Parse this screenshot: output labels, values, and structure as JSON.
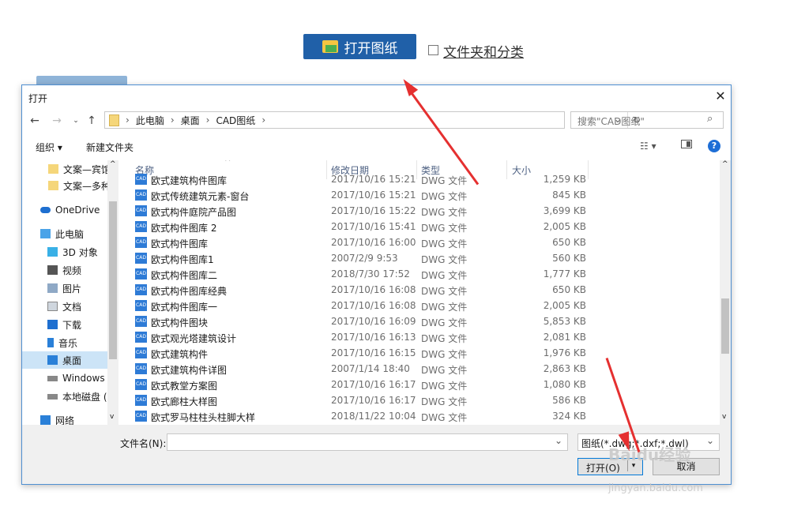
{
  "page": {
    "open_button": "打开图纸",
    "folder_checkbox_label": "文件夹和分类"
  },
  "dialog": {
    "title": "打开",
    "close": "✕",
    "breadcrumb": [
      "此电脑",
      "桌面",
      "CAD图纸"
    ],
    "search_placeholder": "搜索\"CAD图纸\"",
    "toolbar": {
      "organize": "组织 ▾",
      "new_folder": "新建文件夹",
      "help": "?"
    },
    "nav_items": [
      {
        "label": "文案—宾馆",
        "icon": "folder-icon"
      },
      {
        "label": "文案—多种",
        "icon": "folder-icon"
      },
      {
        "label": "OneDrive",
        "icon": "onedrive-icon"
      },
      {
        "label": "此电脑",
        "icon": "computer-icon"
      },
      {
        "label": "3D 对象",
        "icon": "3d-objects-icon"
      },
      {
        "label": "视频",
        "icon": "video-icon"
      },
      {
        "label": "图片",
        "icon": "pictures-icon"
      },
      {
        "label": "文档",
        "icon": "documents-icon"
      },
      {
        "label": "下载",
        "icon": "download-icon"
      },
      {
        "label": "音乐",
        "icon": "music-icon"
      },
      {
        "label": "桌面",
        "icon": "desktop-icon"
      },
      {
        "label": "Windows (",
        "icon": "drive-icon"
      },
      {
        "label": "本地磁盘 (I",
        "icon": "drive-icon"
      },
      {
        "label": "网络",
        "icon": "network-icon"
      }
    ],
    "columns": {
      "name": "名称",
      "date": "修改日期",
      "type": "类型",
      "size": "大小"
    },
    "files": [
      {
        "name": "欧式建筑构件图库",
        "date": "2017/10/16 15:21",
        "type": "DWG 文件",
        "size": "1,259 KB"
      },
      {
        "name": "欧式传统建筑元素-窗台",
        "date": "2017/10/16 15:21",
        "type": "DWG 文件",
        "size": "845 KB"
      },
      {
        "name": "欧式构件庭院产品图",
        "date": "2017/10/16 15:22",
        "type": "DWG 文件",
        "size": "3,699 KB"
      },
      {
        "name": "欧式构件图库 2",
        "date": "2017/10/16 15:41",
        "type": "DWG 文件",
        "size": "2,005 KB"
      },
      {
        "name": "欧式构件图库",
        "date": "2017/10/16 16:00",
        "type": "DWG 文件",
        "size": "650 KB"
      },
      {
        "name": "欧式构件图库1",
        "date": "2007/2/9 9:53",
        "type": "DWG 文件",
        "size": "560 KB"
      },
      {
        "name": "欧式构件图库二",
        "date": "2018/7/30 17:52",
        "type": "DWG 文件",
        "size": "1,777 KB"
      },
      {
        "name": "欧式构件图库经典",
        "date": "2017/10/16 16:08",
        "type": "DWG 文件",
        "size": "650 KB"
      },
      {
        "name": "欧式构件图库一",
        "date": "2017/10/16 16:08",
        "type": "DWG 文件",
        "size": "2,005 KB"
      },
      {
        "name": "欧式构件图块",
        "date": "2017/10/16 16:09",
        "type": "DWG 文件",
        "size": "5,853 KB"
      },
      {
        "name": "欧式观光塔建筑设计",
        "date": "2017/10/16 16:13",
        "type": "DWG 文件",
        "size": "2,081 KB"
      },
      {
        "name": "欧式建筑构件",
        "date": "2017/10/16 16:15",
        "type": "DWG 文件",
        "size": "1,976 KB"
      },
      {
        "name": "欧式建筑构件详图",
        "date": "2007/1/14 18:40",
        "type": "DWG 文件",
        "size": "2,863 KB"
      },
      {
        "name": "欧式教堂方案图",
        "date": "2017/10/16 16:17",
        "type": "DWG 文件",
        "size": "1,080 KB"
      },
      {
        "name": "欧式廊柱大样图",
        "date": "2017/10/16 16:17",
        "type": "DWG 文件",
        "size": "586 KB"
      },
      {
        "name": "欧式罗马柱柱头柱脚大样",
        "date": "2018/11/22 10:04",
        "type": "DWG 文件",
        "size": "324 KB"
      }
    ],
    "file_icon_text": "CAD",
    "filename_label": "文件名(N):",
    "filename_value": "",
    "filetype": "图纸(*.dwg;*.dxf;*.dwl)",
    "open_button": "打开(O)",
    "cancel_button": "取消"
  },
  "watermark": {
    "brand": "Baidu经验",
    "url": "jingyan.baidu.com"
  },
  "colors": {
    "accent": "#2060a8",
    "selection": "#cce4f7",
    "arrow": "#e53030"
  }
}
